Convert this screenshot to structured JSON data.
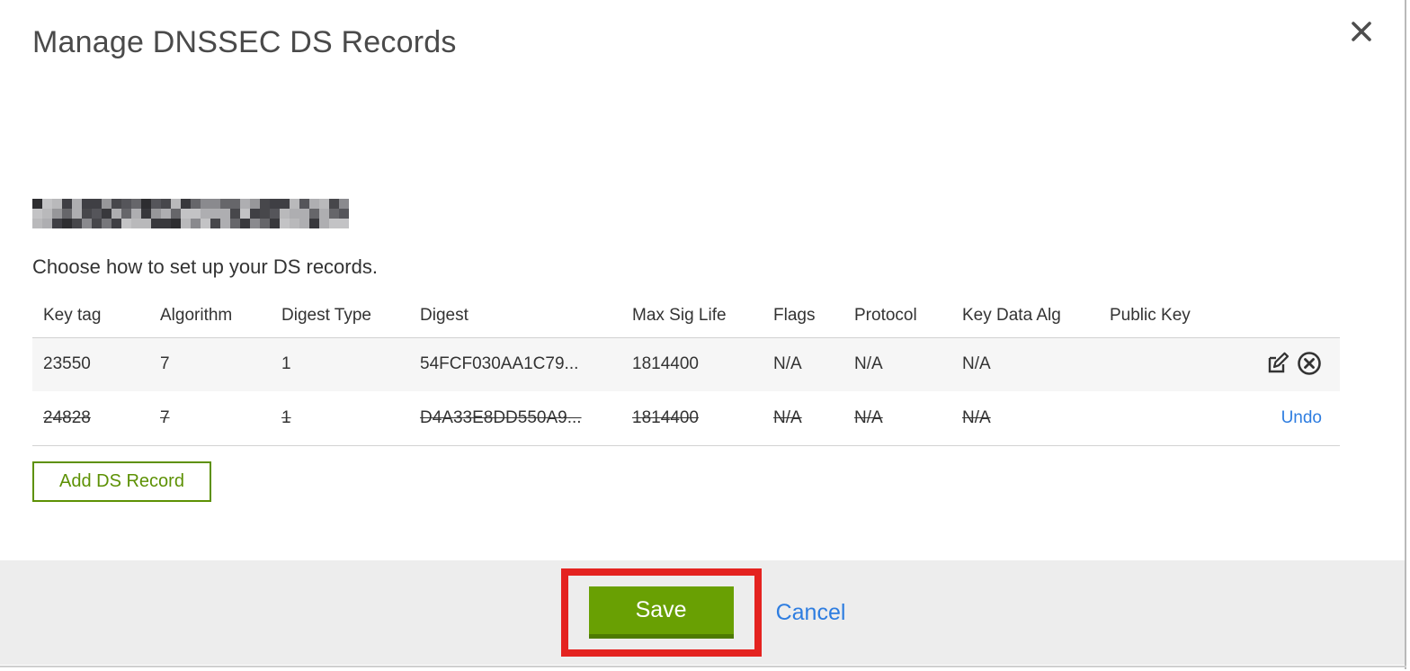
{
  "modal": {
    "title": "Manage DNSSEC DS Records"
  },
  "body": {
    "instruction": "Choose how to set up your DS records.",
    "table": {
      "columns": [
        "Key tag",
        "Algorithm",
        "Digest Type",
        "Digest",
        "Max Sig Life",
        "Flags",
        "Protocol",
        "Key Data Alg",
        "Public Key"
      ],
      "rows": [
        {
          "cells": [
            "23550",
            "7",
            "1",
            "54FCF030AA1C79...",
            "1814400",
            "N/A",
            "N/A",
            "N/A",
            ""
          ],
          "state": "active"
        },
        {
          "cells": [
            "24828",
            "7",
            "1",
            "D4A33E8DD550A9...",
            "1814400",
            "N/A",
            "N/A",
            "N/A",
            ""
          ],
          "state": "deleted",
          "undo_label": "Undo"
        }
      ]
    },
    "add_button_label": "Add DS Record"
  },
  "footer": {
    "save_label": "Save",
    "cancel_label": "Cancel"
  },
  "colors": {
    "brand_green": "#69a003",
    "brand_green_dark": "#4d7a02",
    "outline_green": "#5d9104",
    "link_blue": "#2e7de0",
    "annotation_red": "#e42320",
    "footer_bg": "#ededed",
    "row_highlight_bg": "#f6f6f6",
    "text": "#333333"
  }
}
